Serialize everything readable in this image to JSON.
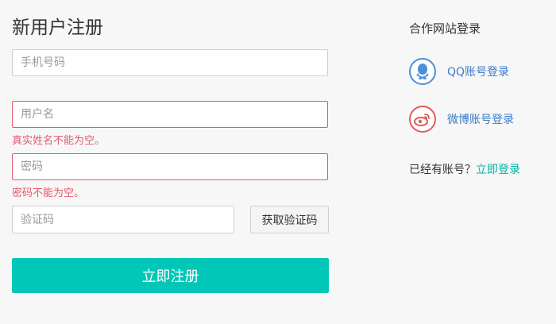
{
  "register": {
    "title": "新用户注册",
    "phone_placeholder": "手机号码",
    "username_placeholder": "用户名",
    "username_error": "真实姓名不能为空。",
    "password_placeholder": "密码",
    "password_error": "密码不能为空。",
    "code_placeholder": "验证码",
    "get_code_label": "获取验证码",
    "submit_label": "立即注册"
  },
  "sidebar": {
    "title": "合作网站登录",
    "qq_label": "QQ账号登录",
    "weibo_label": "微博账号登录",
    "have_account_text": "已经有账号？",
    "login_link": "立即登录"
  },
  "colors": {
    "accent": "#00c7b8",
    "error": "#e25b6c",
    "link": "#00b3a5",
    "qq": "#4b8fd6",
    "weibo": "#e25b5b"
  },
  "icons": {
    "qq": "qq-icon",
    "weibo": "weibo-icon"
  }
}
